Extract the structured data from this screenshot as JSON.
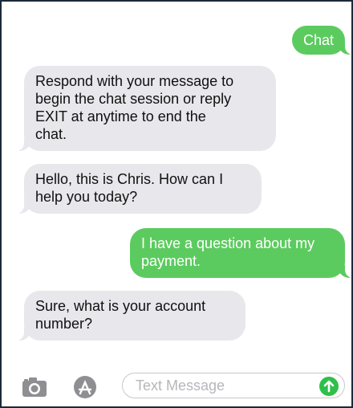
{
  "conversation": {
    "messages": [
      {
        "sender": "me",
        "text": "Chat"
      },
      {
        "sender": "them",
        "lines": [
          "Respond with your message to",
          "begin the chat session or reply",
          "EXIT at anytime to end the",
          "chat."
        ]
      },
      {
        "sender": "them",
        "lines": [
          "Hello, this is Chris. How can I",
          "help you today?"
        ]
      },
      {
        "sender": "me",
        "lines": [
          "I have a question about my",
          "payment."
        ]
      },
      {
        "sender": "them",
        "lines": [
          "Sure, what is your account",
          "number?"
        ]
      }
    ]
  },
  "composer": {
    "placeholder": "Text Message",
    "camera_icon": "camera-icon",
    "apps_icon": "app-store-icon",
    "send_icon": "send-arrow-icon"
  },
  "colors": {
    "outgoing_bubble": "#5ccb5f",
    "incoming_bubble": "#e7e7ec",
    "send_button": "#2fbf4a",
    "frame_border": "#1c2a3a"
  }
}
